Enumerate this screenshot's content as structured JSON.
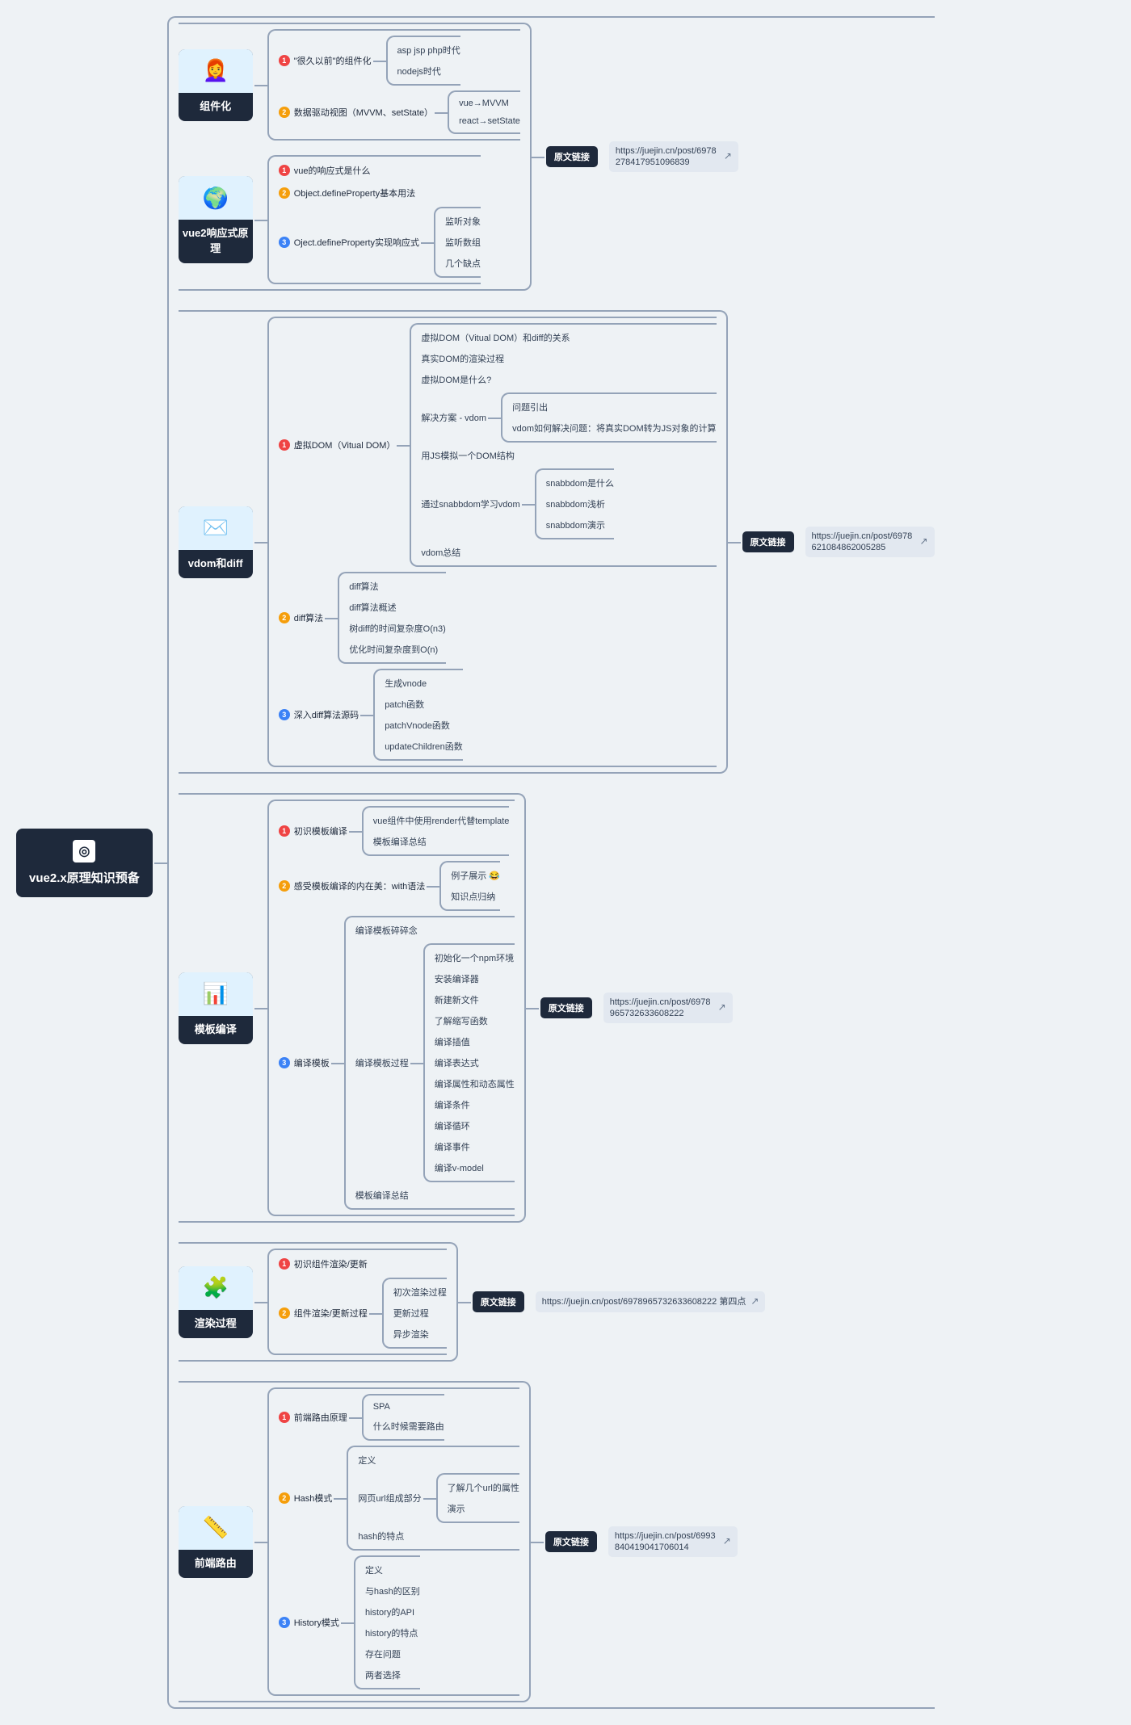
{
  "root": {
    "label": "vue2.x原理知识预备",
    "icon": "◎"
  },
  "linkLabel": "原文链接",
  "categories": [
    {
      "icon": "👩‍🦰",
      "label": "组件化",
      "link": "https://juejin.cn/post/6978278417951096839",
      "shareLinkWith": 1,
      "items": [
        {
          "n": 1,
          "label": "\"很久以前\"的组件化",
          "children": [
            "asp jsp php时代",
            "nodejs时代"
          ]
        },
        {
          "n": 2,
          "label": "数据驱动视图（MVVM、setState）",
          "children": [
            "vue→MVVM",
            "react→setState"
          ]
        }
      ]
    },
    {
      "icon": "🌍",
      "label": "vue2响应式原理",
      "items": [
        {
          "n": 1,
          "label": "vue的响应式是什么"
        },
        {
          "n": 2,
          "label": "Object.defineProperty基本用法"
        },
        {
          "n": 3,
          "label": "Oject.defineProperty实现响应式",
          "children": [
            "监听对象",
            "监听数组",
            "几个缺点"
          ]
        }
      ]
    },
    {
      "icon": "✉️",
      "label": "vdom和diff",
      "link": "https://juejin.cn/post/6978621084862005285",
      "items": [
        {
          "n": 1,
          "label": "虚拟DOM（Vitual DOM）",
          "children": [
            "虚拟DOM（Vitual DOM）和diff的关系",
            "真实DOM的渲染过程",
            "虚拟DOM是什么?",
            {
              "label": "解决方案 - vdom",
              "children": [
                "问题引出",
                "vdom如何解决问题：将真实DOM转为JS对象的计算"
              ]
            },
            "用JS模拟一个DOM结构",
            {
              "label": "通过snabbdom学习vdom",
              "children": [
                "snabbdom是什么",
                "snabbdom浅析",
                "snabbdom演示"
              ]
            },
            "vdom总结"
          ]
        },
        {
          "n": 2,
          "label": "diff算法",
          "children": [
            "diff算法",
            "diff算法概述",
            "树diff的时间复杂度O(n3)",
            "优化时间复杂度到O(n)"
          ]
        },
        {
          "n": 3,
          "label": "深入diff算法源码",
          "children": [
            "生成vnode",
            "patch函数",
            "patchVnode函数",
            "updateChildren函数"
          ]
        }
      ]
    },
    {
      "icon": "📊",
      "label": "模板编译",
      "link": "https://juejin.cn/post/6978965732633608222",
      "items": [
        {
          "n": 1,
          "label": "初识模板编译",
          "children": [
            "vue组件中使用render代替template",
            "模板编译总结"
          ]
        },
        {
          "n": 2,
          "label": "感受模板编译的内在美：with语法",
          "children": [
            "例子展示 😂",
            "知识点归纳"
          ]
        },
        {
          "n": 3,
          "label": "编译模板",
          "children": [
            "编译模板碎碎念",
            {
              "label": "编译模板过程",
              "children": [
                "初始化一个npm环境",
                "安装编译器",
                "新建新文件",
                "了解缩写函数",
                "编译插值",
                "编译表达式",
                "编译属性和动态属性",
                "编译条件",
                "编译循环",
                "编译事件",
                "编译v-model"
              ]
            },
            "模板编译总结"
          ]
        }
      ]
    },
    {
      "icon": "🧩",
      "label": "渲染过程",
      "link": "https://juejin.cn/post/6978965732633608222 第四点",
      "linkWide": true,
      "items": [
        {
          "n": 1,
          "label": "初识组件渲染/更新"
        },
        {
          "n": 2,
          "label": "组件渲染/更新过程",
          "children": [
            "初次渲染过程",
            "更新过程",
            "异步渲染"
          ]
        }
      ]
    },
    {
      "icon": "📏",
      "label": "前端路由",
      "link": "https://juejin.cn/post/6993840419041706014",
      "items": [
        {
          "n": 1,
          "label": "前端路由原理",
          "children": [
            "SPA",
            "什么时候需要路由"
          ]
        },
        {
          "n": 2,
          "label": "Hash模式",
          "children": [
            "定义",
            {
              "label": "网页url组成部分",
              "children": [
                "了解几个url的属性",
                "演示"
              ]
            },
            "hash的特点"
          ]
        },
        {
          "n": 3,
          "label": "History模式",
          "children": [
            "定义",
            "与hash的区别",
            "history的API",
            "history的特点",
            "存在问题",
            "两者选择"
          ]
        }
      ]
    }
  ]
}
